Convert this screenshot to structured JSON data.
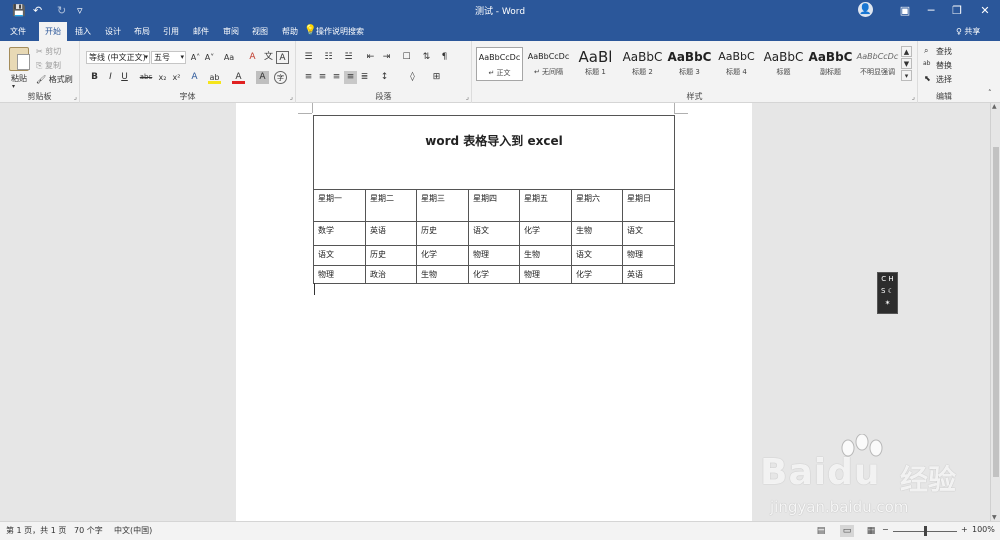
{
  "window": {
    "title": "测试 - Word",
    "minimize": "─",
    "restore": "❐",
    "close": "✕",
    "ribbon_display": "▣"
  },
  "quick_access": {
    "save": "💾",
    "undo": "↶",
    "redo": "↻",
    "customize": "▿"
  },
  "tabs": [
    {
      "label": "文件"
    },
    {
      "label": "开始"
    },
    {
      "label": "插入"
    },
    {
      "label": "设计"
    },
    {
      "label": "布局"
    },
    {
      "label": "引用"
    },
    {
      "label": "邮件"
    },
    {
      "label": "审阅"
    },
    {
      "label": "视图"
    },
    {
      "label": "帮助"
    }
  ],
  "tell_me": "操作说明搜索",
  "share": "♀ 共享",
  "ribbon": {
    "clipboard": {
      "label": "剪贴板",
      "paste": "粘贴",
      "cut": "✂ 剪切",
      "copy": "⎘ 复制",
      "format_painter": "🖌 格式刷"
    },
    "font": {
      "label": "字体",
      "font_name": "等线 (中文正文)",
      "font_size": "五号",
      "grow": "A˄",
      "shrink": "A˅",
      "case": "Aa",
      "clear": "A",
      "phonetic": "文",
      "border": "A",
      "bold": "B",
      "italic": "I",
      "underline": "U",
      "strike": "abc",
      "subscript": "x₂",
      "superscript": "x²",
      "effects": "A",
      "highlight": "ab",
      "color": "A",
      "shading": "A",
      "enclose": "字"
    },
    "paragraph": {
      "label": "段落",
      "bullets": "☰",
      "numbering": "☷",
      "multilevel": "☱",
      "decrease_indent": "⇤",
      "increase_indent": "⇥",
      "chinese_layout": "☐",
      "sort": "⇅",
      "show_marks": "¶",
      "align_left": "≡",
      "center": "≡",
      "align_right": "≡",
      "justify": "≡",
      "distributed": "≣",
      "line_spacing": "↕",
      "shading": "◊",
      "borders": "⊞"
    },
    "styles": {
      "label": "样式",
      "items": [
        {
          "sample": "AaBbCcDc",
          "name": "↵ 正文"
        },
        {
          "sample": "AaBbCcDc",
          "name": "↵ 无间隔"
        },
        {
          "sample": "AaBl",
          "name": "标题 1"
        },
        {
          "sample": "AaBbC",
          "name": "标题 2"
        },
        {
          "sample": "AaBbC",
          "name": "标题 3"
        },
        {
          "sample": "AaBbC",
          "name": "标题 4"
        },
        {
          "sample": "AaBbC",
          "name": "标题"
        },
        {
          "sample": "AaBbC",
          "name": "副标题"
        },
        {
          "sample": "AaBbCcDc",
          "name": "不明显强调"
        }
      ]
    },
    "editing": {
      "label": "编辑",
      "find": "查找",
      "replace": "替换",
      "select": "选择"
    }
  },
  "document": {
    "table_title": "word 表格导入到 excel",
    "rows": [
      [
        "星期一",
        "星期二",
        "星期三",
        "星期四",
        "星期五",
        "星期六",
        "星期日"
      ],
      [
        "数学",
        "英语",
        "历史",
        "语文",
        "化学",
        "生物",
        "语文"
      ],
      [
        "语文",
        "历史",
        "化学",
        "物理",
        "生物",
        "语文",
        "物理"
      ],
      [
        "物理",
        "政治",
        "生物",
        "化学",
        "物理",
        "化学",
        "英语"
      ]
    ]
  },
  "ime": {
    "line1": "C H",
    "line2": "S ☾",
    "line3": "✶"
  },
  "watermark": {
    "brand": "Bai",
    "brand_du": "du",
    "brand_cn": "经验",
    "url": "jingyan.baidu.com"
  },
  "status": {
    "page": "第 1 页，共 1 页",
    "words": "70 个字",
    "language": "中文(中国)",
    "zoom_out": "−",
    "zoom_in": "+",
    "zoom": "100%"
  }
}
